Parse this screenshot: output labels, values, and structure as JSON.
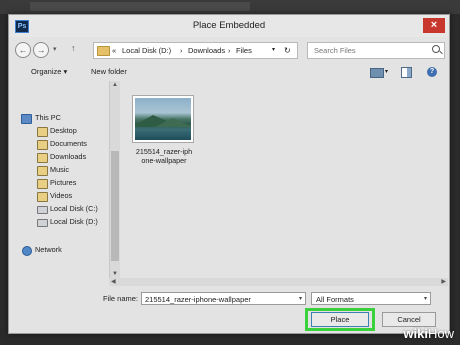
{
  "app": {
    "icon_text": "Ps"
  },
  "dialog": {
    "title": "Place Embedded",
    "close_glyph": "×"
  },
  "nav": {
    "back": "←",
    "forward": "→",
    "dropdown": "▾",
    "up": "↑"
  },
  "breadcrumb": {
    "overflow": "«",
    "items": [
      "Local Disk (D:)",
      "Downloads",
      "Files"
    ],
    "separator": "›",
    "dropdown": "▾",
    "refresh": "↻"
  },
  "search": {
    "placeholder": "Search Files"
  },
  "toolbar": {
    "organize": "Organize ▾",
    "new_folder": "New folder",
    "view_dropdown": "▾",
    "help": "?"
  },
  "sidebar": {
    "items": [
      {
        "label": "This PC",
        "icon": "computer-icon"
      },
      {
        "label": "Desktop",
        "icon": "folder-icon"
      },
      {
        "label": "Documents",
        "icon": "folder-icon"
      },
      {
        "label": "Downloads",
        "icon": "folder-icon"
      },
      {
        "label": "Music",
        "icon": "folder-icon"
      },
      {
        "label": "Pictures",
        "icon": "folder-icon"
      },
      {
        "label": "Videos",
        "icon": "folder-icon"
      },
      {
        "label": "Local Disk (C:)",
        "icon": "drive-icon"
      },
      {
        "label": "Local Disk (D:)",
        "icon": "drive-icon"
      },
      {
        "label": "Network",
        "icon": "network-icon"
      }
    ]
  },
  "scroll": {
    "up": "▲",
    "down": "▼",
    "left": "◀",
    "right": "▶"
  },
  "files": [
    {
      "name": "215514_razer-iphone-wallpaper",
      "name_line1": "215514_razer-iph",
      "name_line2": "one-wallpaper"
    }
  ],
  "footer": {
    "filename_label": "File name:",
    "filename_value": "215514_razer-iphone-wallpaper",
    "format_value": "All Formats",
    "place_label": "Place",
    "cancel_label": "Cancel",
    "dropdown": "▾"
  },
  "watermark": {
    "bold": "wiki",
    "light": "How"
  },
  "colors": {
    "highlight": "#3ad23a",
    "close": "#c8372d"
  }
}
